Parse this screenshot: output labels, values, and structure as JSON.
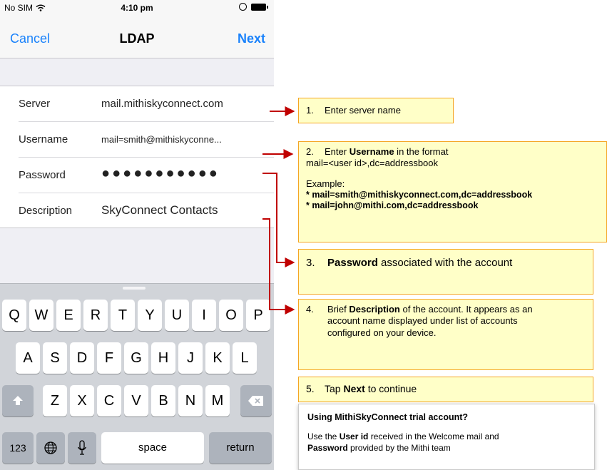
{
  "status_bar": {
    "carrier": "No SIM",
    "time": "4:10 pm"
  },
  "nav": {
    "cancel": "Cancel",
    "title": "LDAP",
    "next": "Next"
  },
  "form": {
    "rows": [
      {
        "label": "Server",
        "value": "mail.mithiskyconnect.com"
      },
      {
        "label": "Username",
        "value": "mail=smith@mithiskyconne..."
      },
      {
        "label": "Password",
        "value": "●●●●●●●●●●●"
      },
      {
        "label": "Description",
        "value": "SkyConnect Contacts"
      }
    ]
  },
  "keyboard": {
    "row1": [
      "Q",
      "W",
      "E",
      "R",
      "T",
      "Y",
      "U",
      "I",
      "O",
      "P"
    ],
    "row2": [
      "A",
      "S",
      "D",
      "F",
      "G",
      "H",
      "J",
      "K",
      "L"
    ],
    "row3": [
      "Z",
      "X",
      "C",
      "V",
      "B",
      "N",
      "M"
    ],
    "numbers": "123",
    "space": "space",
    "return": "return",
    "icons": {
      "shift": "shift-icon",
      "delete": "delete-icon",
      "globe": "globe-icon",
      "mic": "microphone-icon"
    }
  },
  "callouts": {
    "c1": {
      "num": "1.",
      "text": "Enter server name"
    },
    "c2": {
      "num": "2.",
      "pre": "Enter ",
      "bold": "Username",
      "post": " in the format",
      "format": "mail=<user id>,dc=addressbook",
      "example_label": "Example:",
      "example1": "* mail=smith@mithiskyconnect.com,dc=addressbook",
      "example2": "* mail=john@mithi.com,dc=addressbook"
    },
    "c3": {
      "num": "3.",
      "bold": "Password",
      "post": " associated with the account"
    },
    "c4": {
      "num": "4.",
      "pre": "Brief ",
      "bold": "Description",
      "post": " of the account. It appears as an account name displayed under list of accounts configured on your device."
    },
    "c5": {
      "num": "5.",
      "pre": "Tap ",
      "bold": "Next",
      "post": " to continue"
    }
  },
  "info": {
    "title": "Using MithiSkyConnect trial account?",
    "l1_pre": "Use the ",
    "l1_bold": "User id",
    "l1_post": " received in the Welcome mail and",
    "l2_bold": "Password",
    "l2_post": " provided by the Mithi team"
  },
  "colors": {
    "accent": "#1a82fb",
    "arrow": "#c00000",
    "callout_bg": "#ffffc8",
    "callout_border": "#f5a623"
  }
}
